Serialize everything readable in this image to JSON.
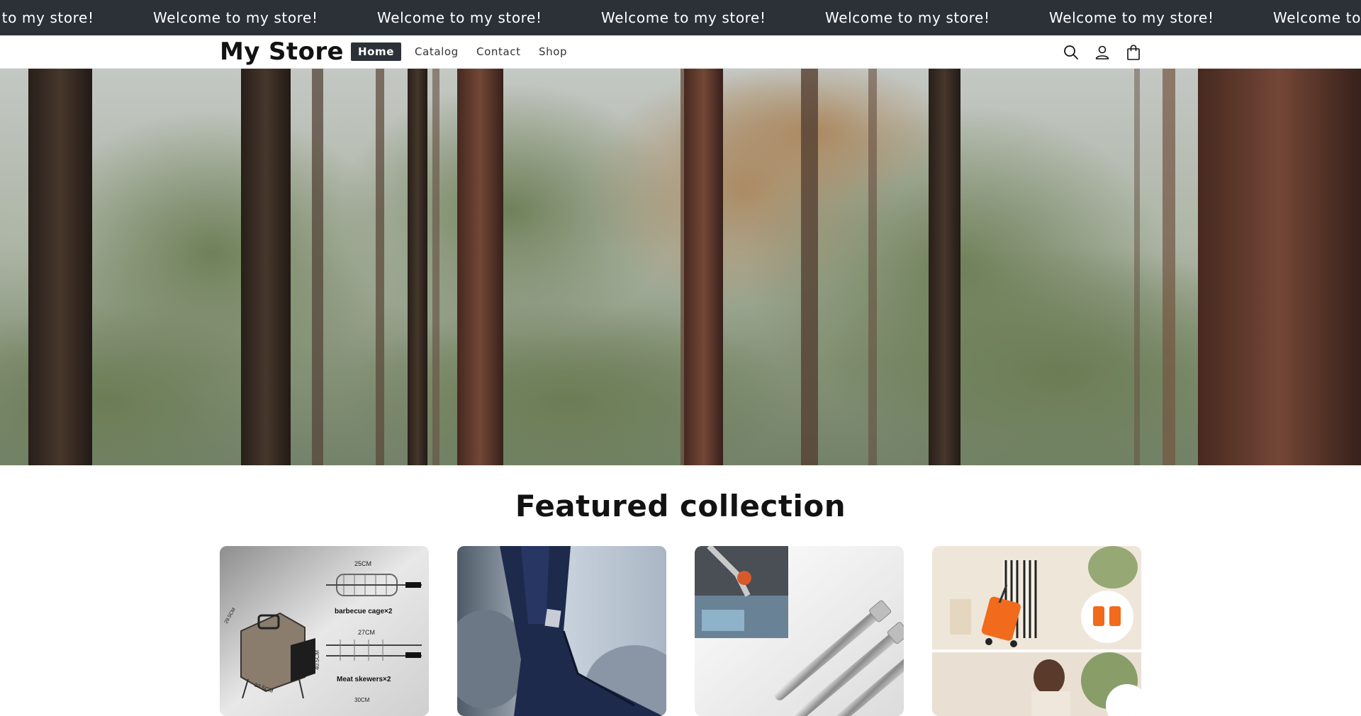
{
  "announcement": {
    "text": "Welcome to my store!",
    "repeat_count": 7
  },
  "header": {
    "logo": "My Store",
    "nav": [
      {
        "label": "Home",
        "active": true
      },
      {
        "label": "Catalog",
        "active": false
      },
      {
        "label": "Contact",
        "active": false
      },
      {
        "label": "Shop",
        "active": false
      }
    ],
    "icons": [
      "search-icon",
      "account-icon",
      "cart-icon"
    ]
  },
  "hero": {
    "image": "forest-of-tall-pine-trees"
  },
  "featured": {
    "title": "Featured collection",
    "products": [
      {
        "image": "rotisserie-barbecue-grill-with-cage",
        "image_labels": [
          "25CM",
          "barbecue cage×2",
          "27CM",
          "40.5CM",
          "Meat skewers×2",
          "29.5CM",
          "32.5CM",
          "30CM"
        ]
      },
      {
        "image": "waterproof-boot-covers-on-legs"
      },
      {
        "image": "flexible-socket-extension-bars"
      },
      {
        "image": "orange-foldable-shopping-trolley-bag"
      }
    ]
  },
  "colors": {
    "announcement_bg": "#2b3137",
    "active_nav_bg": "#2b3137",
    "text": "#121212"
  }
}
